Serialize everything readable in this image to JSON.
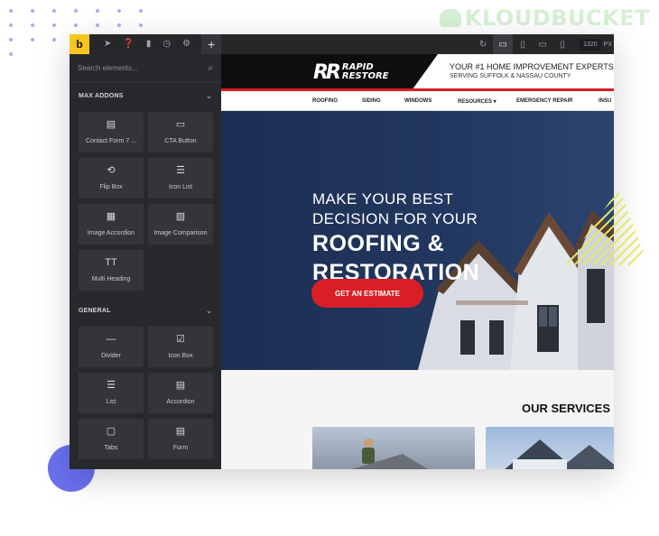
{
  "watermark": {
    "text": "KLOUDBUCKET"
  },
  "editor": {
    "logo_letter": "b",
    "toolbar_icons": [
      "cursor-icon",
      "help-icon",
      "page-icon",
      "history-icon",
      "settings-icon"
    ],
    "add_label": "+",
    "width_value": "1320",
    "width_unit": "PX"
  },
  "sidebar": {
    "search_placeholder": "Search elements...",
    "category_max": "MAX ADDONS",
    "category_general": "GENERAL",
    "max_addons": [
      {
        "label": "Contact Form 7 ...",
        "icon": "contact-form-icon"
      },
      {
        "label": "CTA Button",
        "icon": "cta-button-icon"
      },
      {
        "label": "Flip Box",
        "icon": "flip-box-icon"
      },
      {
        "label": "Icon List",
        "icon": "icon-list-icon"
      },
      {
        "label": "Image Accordion",
        "icon": "image-accordion-icon"
      },
      {
        "label": "Image Comparison",
        "icon": "image-comparison-icon"
      },
      {
        "label": "Multi Heading",
        "icon": "multi-heading-icon"
      }
    ],
    "general": [
      {
        "label": "Divider",
        "icon": "divider-icon"
      },
      {
        "label": "Icon Box",
        "icon": "icon-box-icon"
      },
      {
        "label": "List",
        "icon": "list-icon"
      },
      {
        "label": "Accordion",
        "icon": "accordion-icon"
      },
      {
        "label": "Tabs",
        "icon": "tabs-icon"
      },
      {
        "label": "Form",
        "icon": "form-icon"
      }
    ]
  },
  "site": {
    "logo_mark": "RR",
    "logo_line1": "RAPID",
    "logo_line2": "RESTORE",
    "tagline1": "YOUR #1 HOME IMPROVEMENT EXPERTS",
    "tagline2": "SERVING SUFFOLK & NASSAU COUNTY",
    "nav": [
      "ROOFING",
      "SIDING",
      "WINDOWS",
      "RESOURCES ▾",
      "EMERGENCY REPAIR",
      "INSU"
    ],
    "hero_line1": "MAKE YOUR BEST",
    "hero_line2": "DECISION FOR YOUR",
    "hero_line3": "ROOFING &",
    "hero_line4": "RESTORATION",
    "cta_label": "GET AN ESTIMATE",
    "services_title": "OUR SERVICES"
  },
  "colors": {
    "accent_red": "#d81f26",
    "editor_dark": "#27292c",
    "brand_yellow": "#f7c51e",
    "hero_navy": "#1f3358"
  }
}
